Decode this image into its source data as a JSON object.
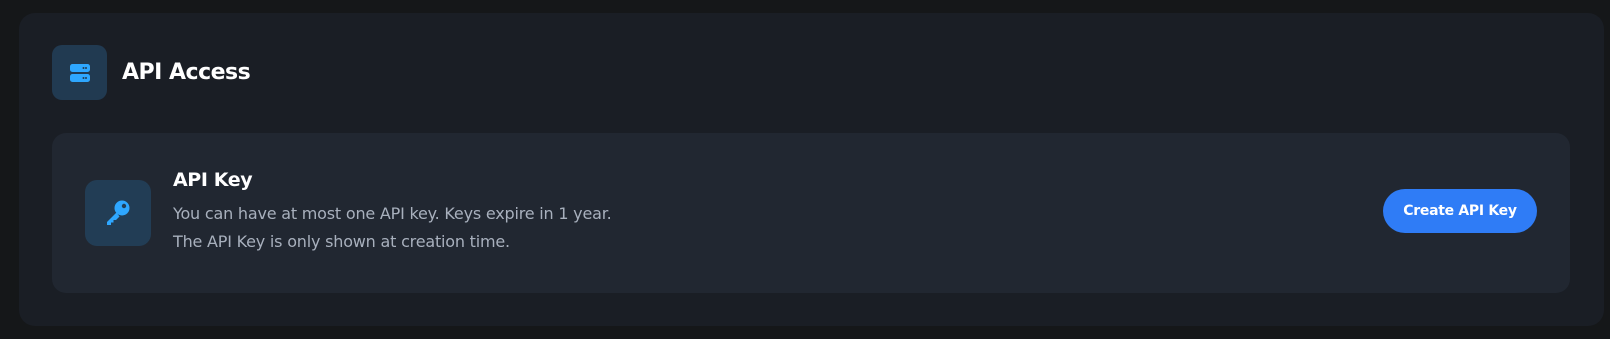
{
  "section": {
    "title": "API Access",
    "icon": "server-icon"
  },
  "api_key_card": {
    "icon": "key-icon",
    "title": "API Key",
    "description_line1": "You can have at most one API key. Keys expire in 1 year.",
    "description_line2": "The API Key is only shown at creation time.",
    "create_button_label": "Create API Key"
  },
  "colors": {
    "background": "#151719",
    "panel": "#1a1e25",
    "card": "#212731",
    "icon_tile": "#213a51",
    "icon_accent": "#2ea7ff",
    "button": "#2f7cf6",
    "text_primary": "#ffffff",
    "text_secondary": "#a8b0bd"
  }
}
